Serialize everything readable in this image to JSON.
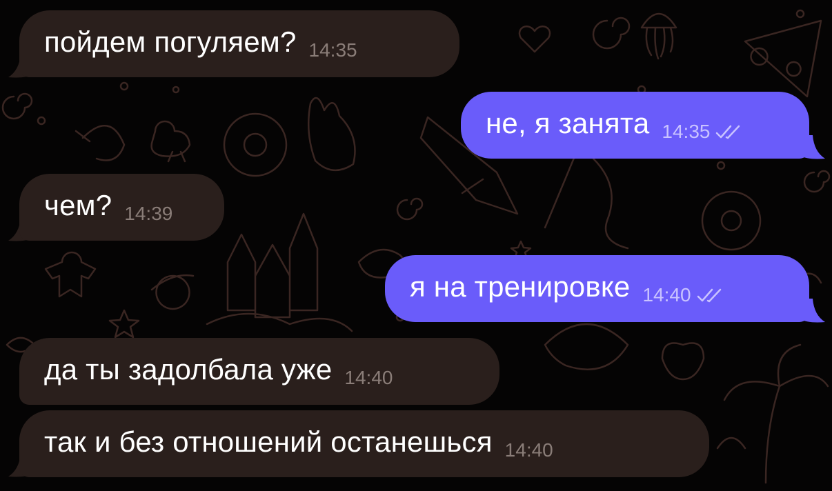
{
  "colors": {
    "background": "#050404",
    "incoming_bubble": "#2a1f1c",
    "outgoing_bubble": "#6a5cfa",
    "text": "#ffffff",
    "incoming_time": "#8a7d78",
    "outgoing_time": "#c9c3ff",
    "pattern_stroke": "#3a2622"
  },
  "messages": [
    {
      "direction": "in",
      "text": "пойдем погуляем?",
      "time": "14:35"
    },
    {
      "direction": "out",
      "text": "не, я занята",
      "time": "14:35",
      "status_icon": "double-check-icon"
    },
    {
      "direction": "in",
      "text": "чем?",
      "time": "14:39"
    },
    {
      "direction": "out",
      "text": "я на тренировке",
      "time": "14:40",
      "status_icon": "double-check-icon"
    },
    {
      "direction": "in",
      "text": "да ты задолбала уже",
      "time": "14:40"
    },
    {
      "direction": "in",
      "text": "так и без отношений останешься",
      "time": "14:40"
    }
  ]
}
